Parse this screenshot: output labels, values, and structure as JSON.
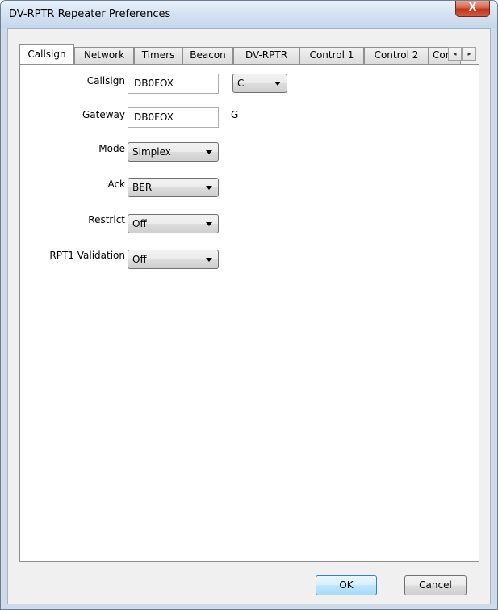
{
  "window": {
    "title": "DV-RPTR Repeater Preferences",
    "close_glyph": "X"
  },
  "tabs": [
    {
      "label": "Callsign",
      "active": true
    },
    {
      "label": "Network"
    },
    {
      "label": "Timers"
    },
    {
      "label": "Beacon"
    },
    {
      "label": "DV-RPTR"
    },
    {
      "label": "Control 1"
    },
    {
      "label": "Control 2"
    },
    {
      "label": "Cor"
    }
  ],
  "tab_scroll": {
    "left": "◂",
    "right": "▸"
  },
  "form": {
    "callsign": {
      "label": "Callsign",
      "value": "DB0FOX",
      "suffix_value": "C"
    },
    "gateway": {
      "label": "Gateway",
      "value": "DB0FOX",
      "suffix": "G"
    },
    "mode": {
      "label": "Mode",
      "value": "Simplex"
    },
    "ack": {
      "label": "Ack",
      "value": "BER"
    },
    "restrict": {
      "label": "Restrict",
      "value": "Off"
    },
    "rpt1_validation": {
      "label": "RPT1 Validation",
      "value": "Off"
    }
  },
  "buttons": {
    "ok": "OK",
    "cancel": "Cancel"
  }
}
